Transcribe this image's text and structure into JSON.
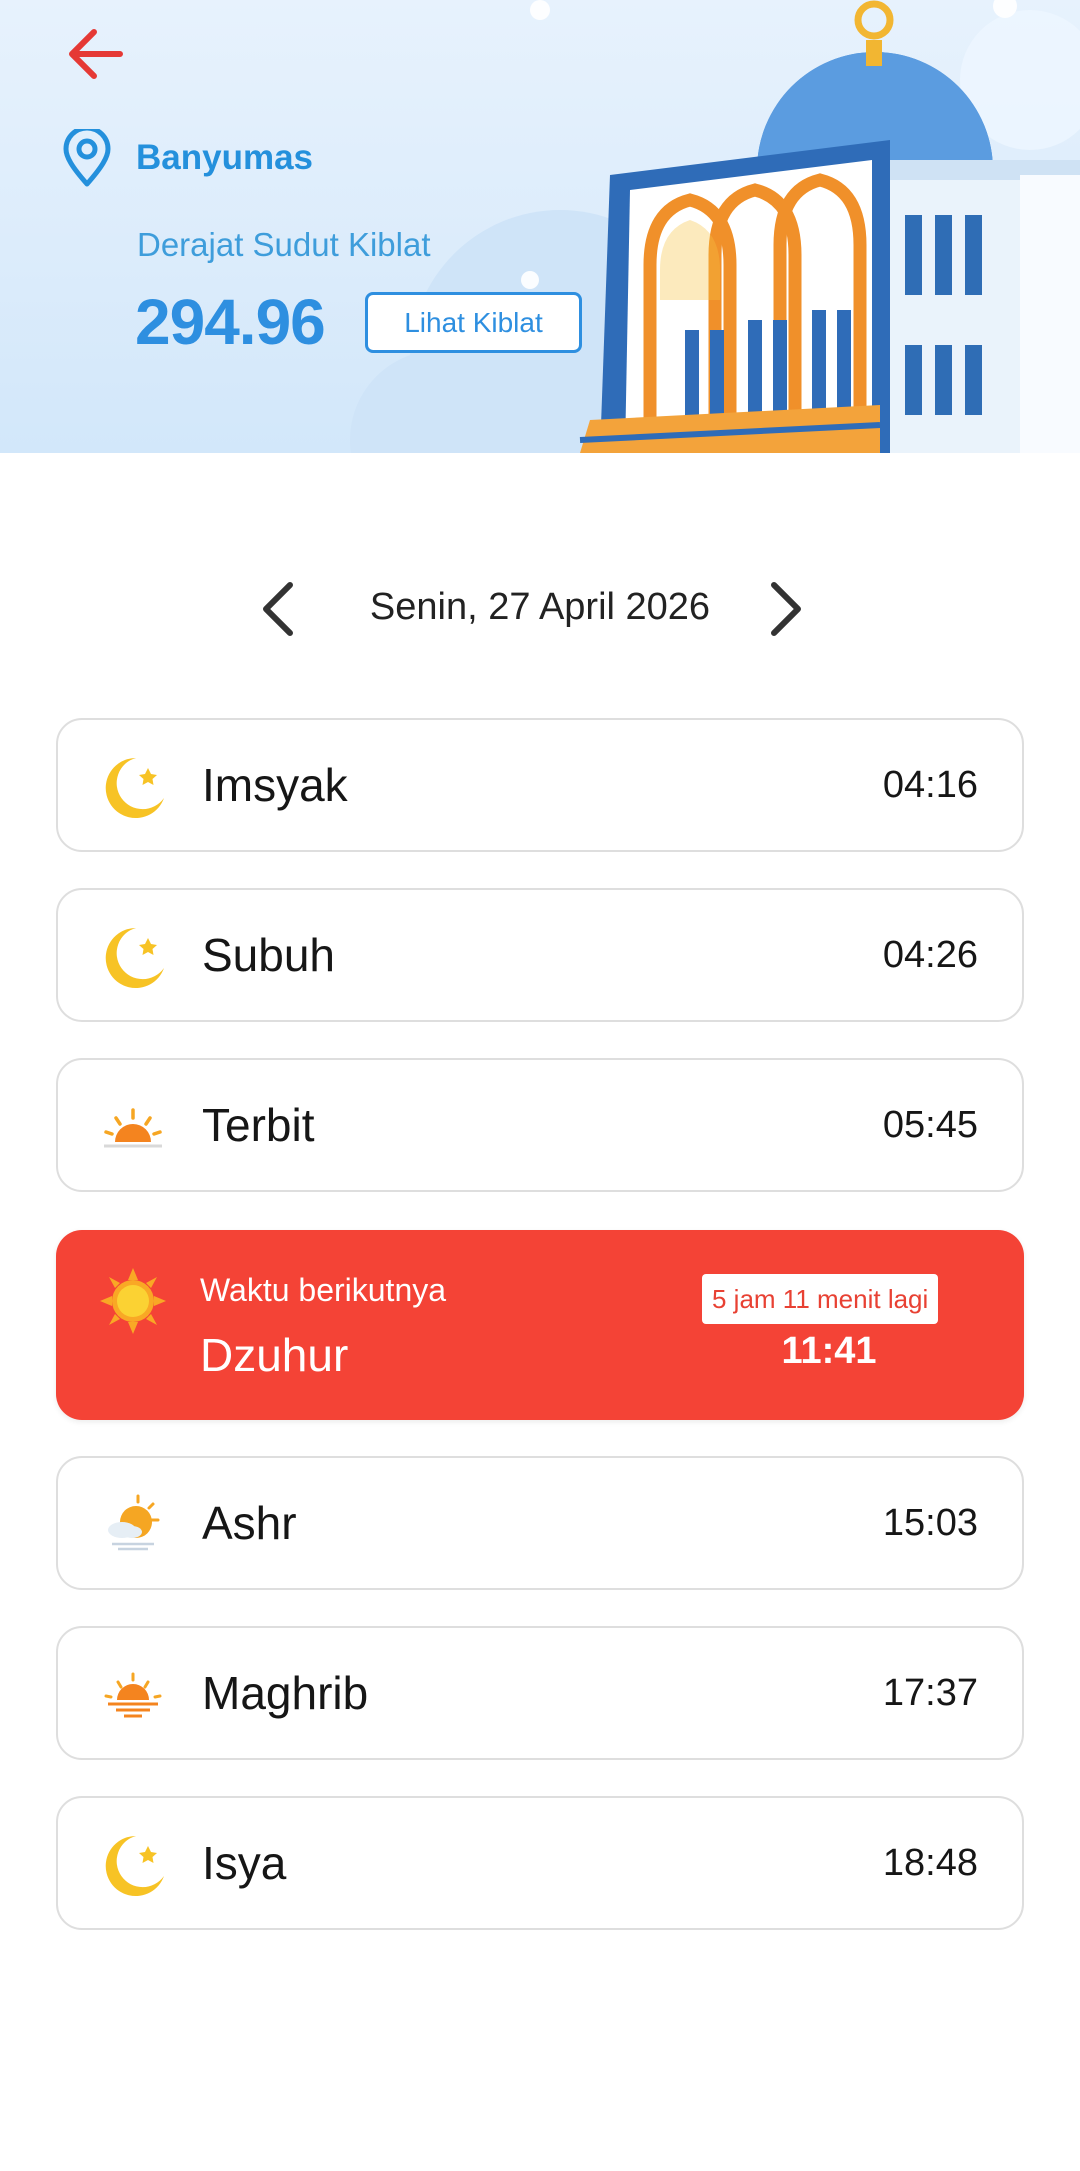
{
  "header": {
    "back_icon": "arrow-left-icon",
    "location_icon": "map-pin-icon",
    "location": "Banyumas",
    "qibla_label": "Derajat Sudut Kiblat",
    "qibla_degree": "294.96",
    "qibla_button": "Lihat Kiblat",
    "illustration": "mosque-illustration",
    "colors": {
      "accent": "#2e8fe0",
      "back": "#e53935",
      "background": "#e3f0fc"
    }
  },
  "date_nav": {
    "prev_icon": "chevron-left-icon",
    "next_icon": "chevron-right-icon",
    "date": "Senin, 27 April 2026"
  },
  "prayers": [
    {
      "name": "Imsyak",
      "time": "04:16",
      "icon": "crescent-star-icon"
    },
    {
      "name": "Subuh",
      "time": "04:26",
      "icon": "crescent-star-icon"
    },
    {
      "name": "Terbit",
      "time": "05:45",
      "icon": "sunrise-icon"
    },
    {
      "name": "Ashr",
      "time": "15:03",
      "icon": "sun-cloud-icon"
    },
    {
      "name": "Maghrib",
      "time": "17:37",
      "icon": "sunset-icon"
    },
    {
      "name": "Isya",
      "time": "18:48",
      "icon": "crescent-star-icon"
    }
  ],
  "next_prayer": {
    "label": "Waktu berikutnya",
    "name": "Dzuhur",
    "countdown": "5 jam 11 menit lagi",
    "time": "11:41",
    "icon": "sun-icon",
    "color": "#f44336"
  }
}
